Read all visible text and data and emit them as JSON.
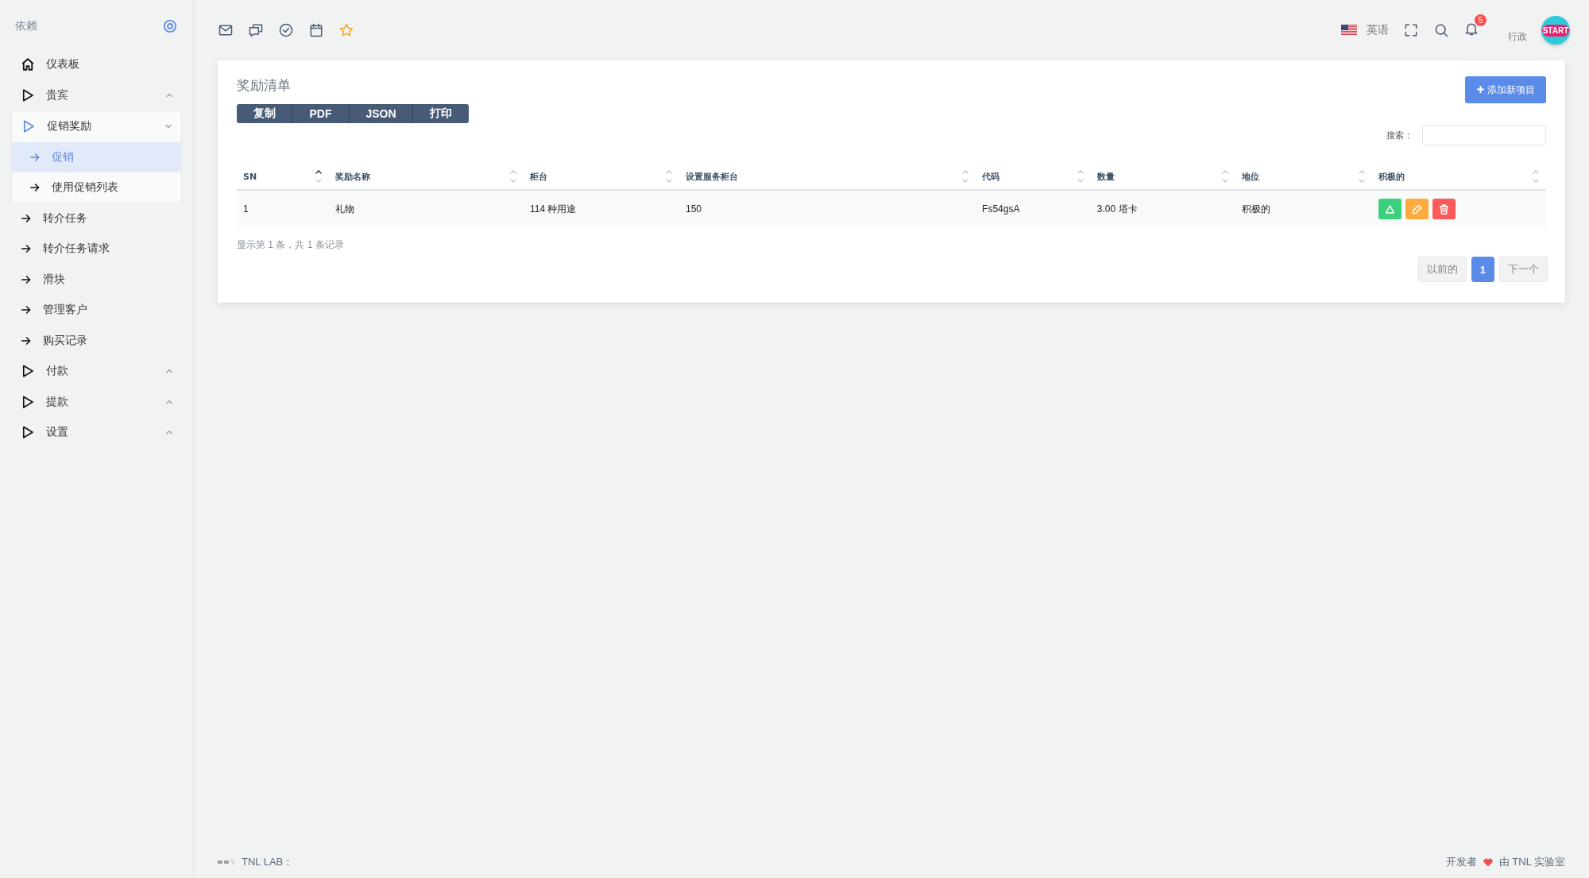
{
  "sidebar": {
    "title": "依赖",
    "items": [
      {
        "kind": "home",
        "label": "仪表板"
      },
      {
        "kind": "group",
        "label": "贵宾",
        "expanded": false
      },
      {
        "kind": "group",
        "label": "促销奖励",
        "expanded": true,
        "children": [
          {
            "label": "促销",
            "selected": true
          },
          {
            "label": "使用促销列表",
            "selected": false
          }
        ]
      },
      {
        "kind": "link",
        "label": "转介任务"
      },
      {
        "kind": "link",
        "label": "转介任务请求"
      },
      {
        "kind": "link",
        "label": "滑块"
      },
      {
        "kind": "link",
        "label": "管理客户"
      },
      {
        "kind": "link",
        "label": "购买记录"
      },
      {
        "kind": "group",
        "label": "付款",
        "expanded": false
      },
      {
        "kind": "group",
        "label": "提款",
        "expanded": false
      },
      {
        "kind": "group",
        "label": "设置",
        "expanded": false
      }
    ]
  },
  "topbar": {
    "language": "英语",
    "notification_count": "5",
    "user": "行政",
    "avatar_text": "START"
  },
  "card": {
    "title": "奖励清单",
    "export_buttons": [
      "复制",
      "PDF",
      "JSON",
      "打印"
    ],
    "add_button": "添加新项目",
    "search_label": "搜索：",
    "table": {
      "columns": [
        {
          "label": "SN",
          "sorted": true
        },
        {
          "label": "奖励名称",
          "sorted": false
        },
        {
          "label": "柜台",
          "sorted": false
        },
        {
          "label": "设置服务柜台",
          "sorted": false
        },
        {
          "label": "代码",
          "sorted": false
        },
        {
          "label": "数量",
          "sorted": false
        },
        {
          "label": "地位",
          "sorted": false
        },
        {
          "label": "积极的",
          "sorted": false
        }
      ],
      "rows": [
        {
          "cells": [
            "1",
            "礼物",
            "114 种用途",
            "150",
            "Fs54gsA",
            "3.00 塔卡",
            "积极的"
          ],
          "actions": [
            {
              "kind": "activate",
              "color": "#3ccf7e"
            },
            {
              "kind": "edit",
              "color": "#fdab3d"
            },
            {
              "kind": "delete",
              "color": "#fc5a5a"
            }
          ]
        }
      ]
    },
    "info": "显示第 1 条，共 1 条记录",
    "pagination": [
      {
        "label": "以前的",
        "disabled": true,
        "selected": false
      },
      {
        "label": "1",
        "disabled": false,
        "selected": true
      },
      {
        "label": "下一个",
        "disabled": true,
        "selected": false
      }
    ]
  },
  "footer": {
    "left": "TNL LAB：",
    "right_prefix": "开发者",
    "right_suffix": "由 TNL 实验室"
  }
}
